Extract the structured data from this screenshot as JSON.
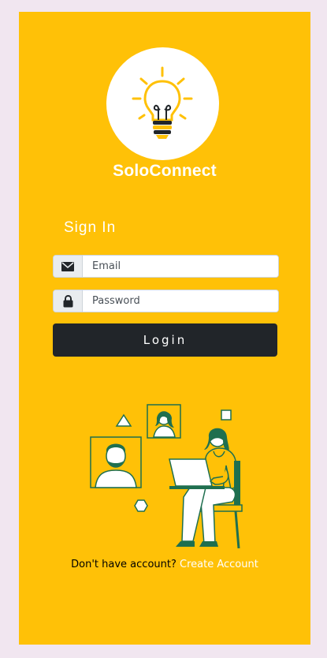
{
  "app": {
    "name": "SoloConnect"
  },
  "form": {
    "heading": "Sign In",
    "email": {
      "placeholder": "Email",
      "icon": "envelope-icon"
    },
    "password": {
      "placeholder": "Password",
      "icon": "lock-icon"
    },
    "login_label": "Login"
  },
  "footer": {
    "prompt": "Don't have account?",
    "link_label": "Create Account"
  },
  "colors": {
    "background": "#f1e6f0",
    "card": "#ffc107",
    "button": "#212529",
    "illustration_accent": "#1f6f4f"
  }
}
